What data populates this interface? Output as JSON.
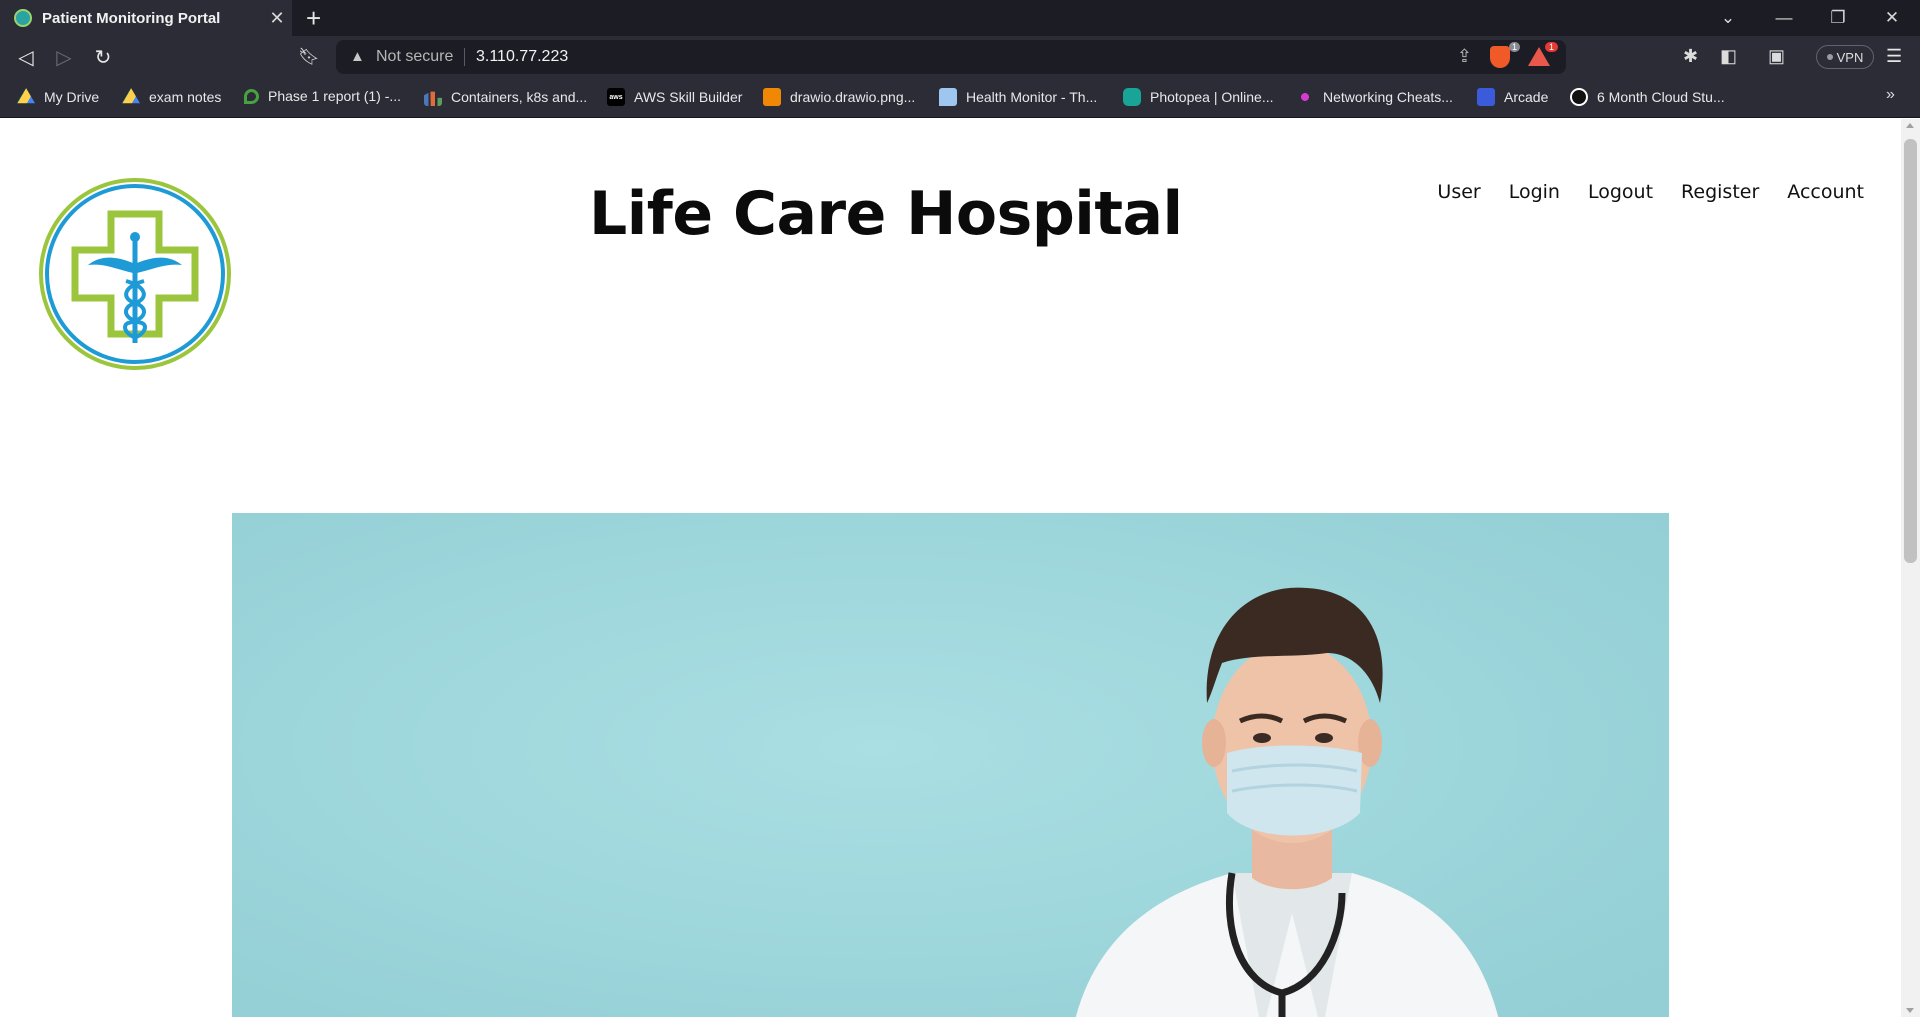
{
  "browser": {
    "tab": {
      "title": "Patient Monitoring Portal"
    },
    "address_bar": {
      "security_label": "Not secure",
      "url": "3.110.77.223"
    },
    "badges": {
      "shield_count": "1",
      "rewards_count": "1"
    },
    "vpn_label": "VPN",
    "bookmarks": [
      {
        "label": "My Drive",
        "icon": "google-drive-icon",
        "color": "#1fa463"
      },
      {
        "label": "exam notes",
        "icon": "google-drive-icon",
        "color": "#4285f4"
      },
      {
        "label": "Phase 1 report (1) -...",
        "icon": "overleaf-icon",
        "color": "#47a141"
      },
      {
        "label": "Containers, k8s and...",
        "icon": "bar-chart-icon",
        "color": "#4a78b8"
      },
      {
        "label": "AWS Skill Builder",
        "icon": "aws-icon",
        "color": "#000000"
      },
      {
        "label": "drawio.drawio.png...",
        "icon": "drawio-icon",
        "color": "#f08705"
      },
      {
        "label": "Health Monitor - Th...",
        "icon": "chat-icon",
        "color": "#9fc6ef"
      },
      {
        "label": "Photopea | Online...",
        "icon": "photopea-icon",
        "color": "#18a497"
      },
      {
        "label": "Networking Cheats...",
        "icon": "network-icon",
        "color": "#d63bd1"
      },
      {
        "label": "Arcade",
        "icon": "arcade-icon",
        "color": "#3b5bdb"
      },
      {
        "label": "6 Month Cloud Stu...",
        "icon": "github-icon",
        "color": "#ffffff"
      }
    ]
  },
  "page": {
    "title": "Life Care Hospital",
    "nav": [
      "User",
      "Login",
      "Logout",
      "Register",
      "Account"
    ],
    "colors": {
      "logo_blue": "#1e9ad6",
      "logo_green": "#9bc53d",
      "hero_bg": "#a2d9de"
    }
  }
}
